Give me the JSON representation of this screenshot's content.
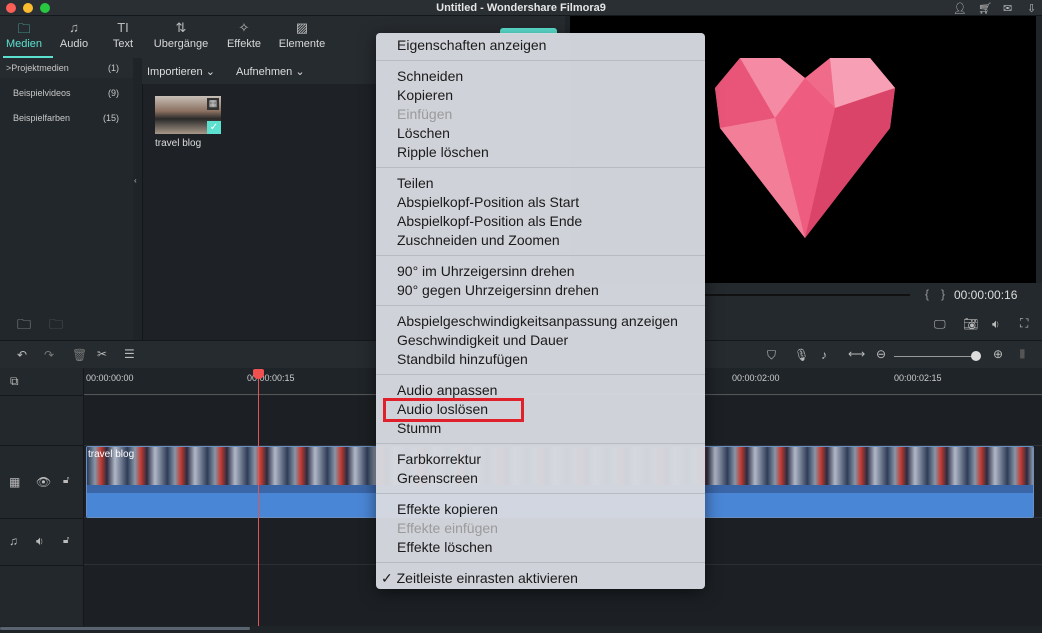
{
  "window": {
    "title": "Untitled - Wondershare Filmora9",
    "icons": [
      "user-icon",
      "cart-icon",
      "mail-icon",
      "download-icon"
    ]
  },
  "tabs": [
    {
      "label": "Medien",
      "icon": "folder-icon",
      "active": true
    },
    {
      "label": "Audio",
      "icon": "music-icon"
    },
    {
      "label": "Text",
      "icon": "text-icon"
    },
    {
      "label": "Übergänge",
      "display": "Ubergänge",
      "icon": "transition-icon"
    },
    {
      "label": "Effekte",
      "icon": "effects-icon"
    },
    {
      "label": "Elemente",
      "icon": "image-icon"
    }
  ],
  "library": [
    {
      "label": "Projektmedien",
      "count": "(1)",
      "arrow": ">"
    },
    {
      "label": "Beispielvideos",
      "count": "(9)"
    },
    {
      "label": "Beispielfarben",
      "count": "(15)"
    }
  ],
  "mediabar": {
    "import": "Importieren",
    "record": "Aufnehmen"
  },
  "media_item": {
    "name": "travel blog"
  },
  "preview": {
    "timecode": "00:00:00:16",
    "brackets_left": "{",
    "brackets_right": "}"
  },
  "ruler": [
    "00:00:00:00",
    "00:00:00:15",
    "00:00:02:00",
    "00:00:02:15"
  ],
  "clip": {
    "label": "travel blog"
  },
  "colors": {
    "accent": "#5ce1d0",
    "playhead": "#f05050",
    "highlight": "#e0202a",
    "heart": "#f06a8a"
  },
  "menu": {
    "groups": [
      [
        {
          "label": "Eigenschaften anzeigen"
        }
      ],
      [
        {
          "label": "Schneiden"
        },
        {
          "label": "Kopieren"
        },
        {
          "label": "Einfügen",
          "disabled": true
        },
        {
          "label": "Löschen"
        },
        {
          "label": "Ripple löschen"
        }
      ],
      [
        {
          "label": "Teilen"
        },
        {
          "label": "Abspielkopf-Position als Start"
        },
        {
          "label": "Abspielkopf-Position als Ende"
        },
        {
          "label": "Zuschneiden und Zoomen"
        }
      ],
      [
        {
          "label": "90° im Uhrzeigersinn drehen"
        },
        {
          "label": "90° gegen Uhrzeigersinn drehen"
        }
      ],
      [
        {
          "label": "Abspielgeschwindigkeitsanpassung anzeigen"
        },
        {
          "label": "Geschwindigkeit und Dauer"
        },
        {
          "label": "Standbild hinzufügen"
        }
      ],
      [
        {
          "label": "Audio anpassen"
        },
        {
          "label": "Audio loslösen",
          "highlighted": true
        },
        {
          "label": "Stumm"
        }
      ],
      [
        {
          "label": "Farbkorrektur"
        },
        {
          "label": "Greenscreen"
        }
      ],
      [
        {
          "label": "Effekte kopieren"
        },
        {
          "label": "Effekte einfügen",
          "disabled": true
        },
        {
          "label": "Effekte löschen"
        }
      ],
      [
        {
          "label": "✓ Zeitleiste einrasten aktivieren",
          "checked": true
        }
      ]
    ]
  }
}
